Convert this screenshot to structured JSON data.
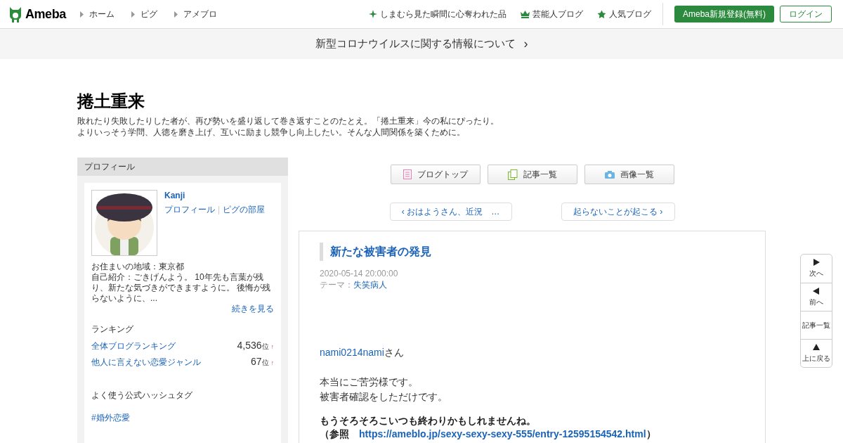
{
  "header": {
    "logo": "Ameba",
    "breadcrumbs": [
      "ホーム",
      "ピグ",
      "アメブロ"
    ],
    "links": [
      {
        "kind": "sparkle",
        "label": "しまむら見た瞬間に心奪われた品"
      },
      {
        "kind": "crown",
        "label": "芸能人ブログ"
      },
      {
        "kind": "star",
        "label": "人気ブログ"
      }
    ],
    "register_button": "Ameba新規登録(無料)",
    "login_button": "ログイン"
  },
  "notice": {
    "text": "新型コロナウイルスに関する情報について",
    "arrow": "›"
  },
  "blog": {
    "title": "捲土重来",
    "description": [
      "敗れたり失敗したりした者が、再び勢いを盛り返して巻き返すことのたとえ。「捲土重来」今の私にぴったり。",
      "よりいっそう学問、人徳を磨き上げ、互いに励まし競争し向上したい。そんな人間関係を築くために。"
    ]
  },
  "sidebar": {
    "heading": "プロフィール",
    "name": "Kanji",
    "profile_links": [
      "プロフィール",
      "ピグの部屋"
    ],
    "separator": "|",
    "region": "お住まいの地域：東京都",
    "intro": "自己紹介：ごきげんよう。 10年先も言葉が残り、新たな気づきができますように。 後悔が残らないように、...",
    "more_link": "続きを見る",
    "ranking_heading": "ランキング",
    "rankings": [
      {
        "label": "全体ブログランキング",
        "rank": "4,536",
        "unit": "位",
        "trend": "↑"
      },
      {
        "label": "他人に言えない恋愛ジャンル",
        "rank": "67",
        "unit": "位",
        "trend": "↑"
      }
    ],
    "hashtag_heading": "よく使う公式ハッシュタグ",
    "hashtags": [
      "#婚外恋愛"
    ]
  },
  "toolbar": [
    {
      "kind": "page",
      "label": "ブログトップ"
    },
    {
      "kind": "pages",
      "label": "記事一覧"
    },
    {
      "kind": "camera",
      "label": "画像一覧"
    }
  ],
  "pager": {
    "prev": "‹ おはようさん、近況　…",
    "next": "起らないことが起こる ›"
  },
  "article": {
    "title": "新たな被害者の発見",
    "date": "2020-05-14 20:00:00",
    "theme_label": "テーマ：",
    "theme": "失笑病人",
    "mention": "nami0214nami",
    "mention_suffix": "さん",
    "lines": [
      "本当にご苦労様です。",
      "被害者確認をしただけです。"
    ],
    "bold_line": "もうそろそろこいつも終わりかもしれませんね。",
    "ref_open": "（参照　",
    "ref_url": "https://ameblo.jp/sexy-sexy-sexy-555/entry-12595154542.html",
    "ref_close": "）"
  },
  "side_nav": [
    {
      "kind": "right",
      "label": "次へ"
    },
    {
      "kind": "left",
      "label": "前へ"
    },
    {
      "kind": "none",
      "label": "記事一覧"
    },
    {
      "kind": "up",
      "label": "上に戻る"
    }
  ]
}
